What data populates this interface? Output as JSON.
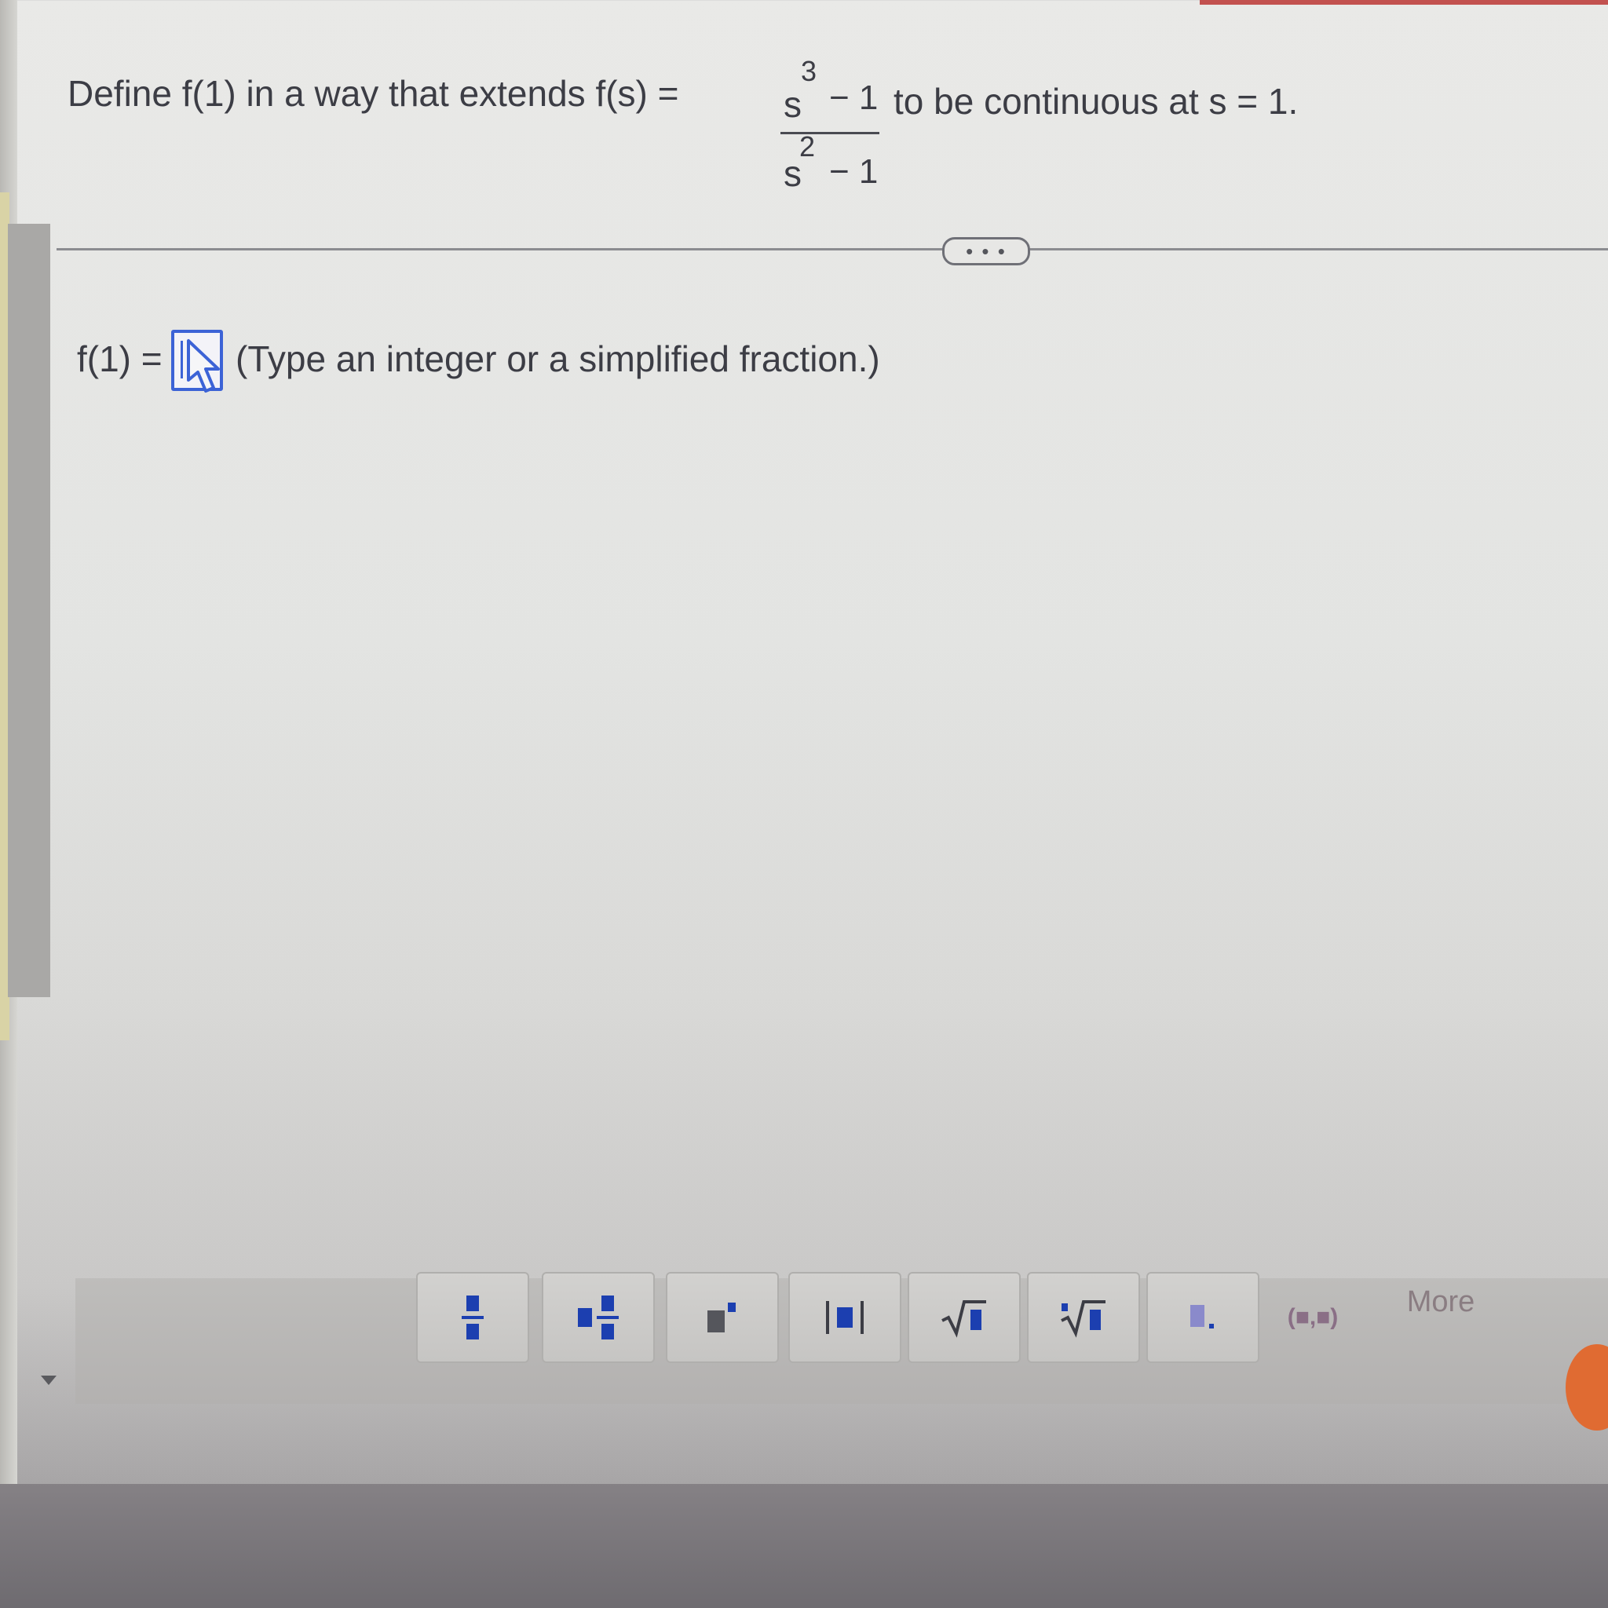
{
  "question": {
    "prefix": "Define f(1) in a way that extends f(s) =",
    "numerator_base": "s",
    "numerator_exp": "3",
    "numerator_rest": "− 1",
    "denominator_base": "s",
    "denominator_exp": "2",
    "denominator_rest": "− 1",
    "suffix": "to be continuous at s = 1."
  },
  "separator": {
    "more_label": "• • •"
  },
  "answer": {
    "label": "f(1) =",
    "value": "",
    "hint": "(Type an integer or a simplified fraction.)"
  },
  "toolbar": {
    "buttons": [
      {
        "name": "fraction",
        "icon": "fraction-icon"
      },
      {
        "name": "mixed-number",
        "icon": "mixed-number-icon"
      },
      {
        "name": "exponent",
        "icon": "exponent-icon"
      },
      {
        "name": "absolute-value",
        "icon": "absolute-value-icon"
      },
      {
        "name": "square-root",
        "icon": "square-root-icon"
      },
      {
        "name": "nth-root",
        "icon": "nth-root-icon"
      },
      {
        "name": "decimal",
        "icon": "decimal-icon"
      },
      {
        "name": "ordered-pair",
        "icon": "ordered-pair-icon",
        "label": "(■,■)"
      }
    ],
    "more_label": "More"
  },
  "colors": {
    "accent": "#3c63d6",
    "toolbar_icon": "#1c3fb0",
    "text": "#3c3d45"
  }
}
